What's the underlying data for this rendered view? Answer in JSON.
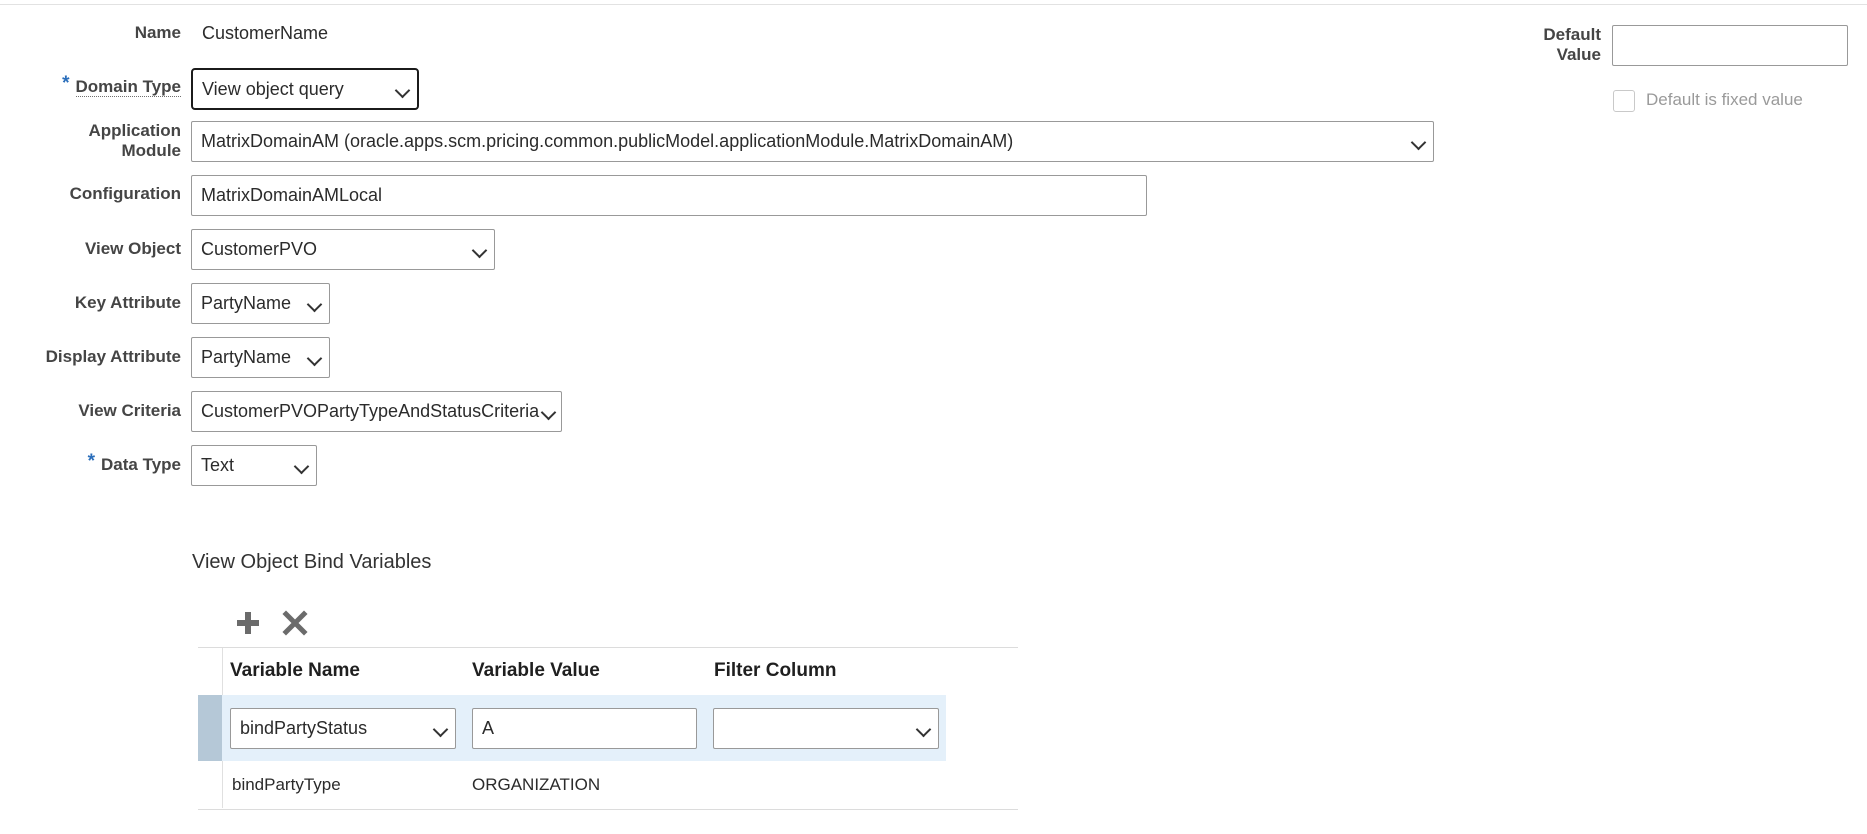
{
  "form": {
    "name_label": "Name",
    "name_value": "CustomerName",
    "domain_type_label": "Domain Type",
    "domain_type_value": "View object query",
    "app_module_label_1": "Application",
    "app_module_label_2": "Module",
    "app_module_value": "MatrixDomainAM (oracle.apps.scm.pricing.common.publicModel.applicationModule.MatrixDomainAM)",
    "configuration_label": "Configuration",
    "configuration_value": "MatrixDomainAMLocal",
    "view_object_label": "View Object",
    "view_object_value": "CustomerPVO",
    "key_attribute_label": "Key Attribute",
    "key_attribute_value": "PartyName",
    "display_attribute_label": "Display Attribute",
    "display_attribute_value": "PartyName",
    "view_criteria_label": "View Criteria",
    "view_criteria_value": "CustomerPVOPartyTypeAndStatusCriteria",
    "data_type_label": "Data Type",
    "data_type_value": "Text",
    "required_marker": "*"
  },
  "default_panel": {
    "default_value_label_1": "Default",
    "default_value_label_2": "Value",
    "default_value": "",
    "fixed_label": "Default is fixed value"
  },
  "bind_vars": {
    "title": "View Object Bind Variables",
    "icons": [
      "add-icon",
      "delete-icon"
    ],
    "columns": [
      "Variable Name",
      "Variable Value",
      "Filter Column"
    ],
    "rows": [
      {
        "name": "bindPartyStatus",
        "value": "A",
        "filter": ""
      },
      {
        "name": "bindPartyType",
        "value": "ORGANIZATION",
        "filter": ""
      }
    ]
  },
  "colors": {
    "required": "#2a6ebb",
    "selected_row": "#e4f0fa",
    "row_marker": "#b5c8d7"
  }
}
